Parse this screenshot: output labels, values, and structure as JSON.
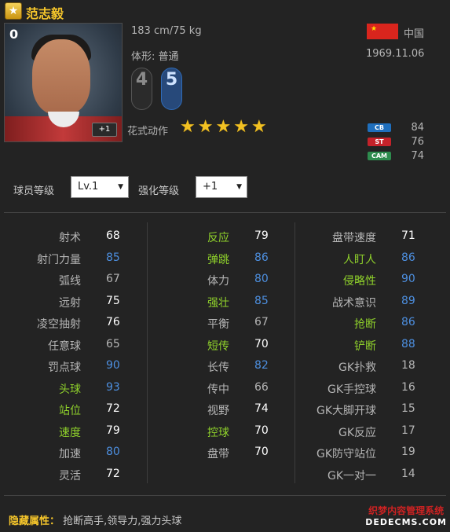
{
  "player": {
    "name": "范志毅",
    "overall": "0",
    "height_weight": "183 cm/75 kg",
    "body_type": "体形: 普通",
    "country": "中国",
    "dob": "1969.11.06",
    "weak_foot": "4",
    "strong_foot": "5",
    "skill_moves_label": "花式动作",
    "skill_stars": 5,
    "enhance_badge": "+1"
  },
  "positions": [
    {
      "tag": "CB",
      "value": "84",
      "color": "#1f6fbd"
    },
    {
      "tag": "ST",
      "value": "76",
      "color": "#c4222a"
    },
    {
      "tag": "CAM",
      "value": "74",
      "color": "#2e8c4e"
    }
  ],
  "controls": {
    "level_label": "球员等级",
    "level_value": "Lv.1",
    "enhance_label": "强化等级",
    "enhance_value": "+1"
  },
  "colors": {
    "green": "#8fd12b",
    "blue": "#4d8fe0",
    "white": "#ffffff",
    "gray": "#b5b5b5",
    "gold": "#f6c62b"
  },
  "stats": {
    "col1": [
      {
        "name": "射术",
        "value": "68",
        "nc": "gray",
        "vc": "white"
      },
      {
        "name": "射门力量",
        "value": "85",
        "nc": "gray",
        "vc": "blue"
      },
      {
        "name": "弧线",
        "value": "67",
        "nc": "gray",
        "vc": "gray"
      },
      {
        "name": "远射",
        "value": "75",
        "nc": "gray",
        "vc": "white"
      },
      {
        "name": "凌空抽射",
        "value": "76",
        "nc": "gray",
        "vc": "white"
      },
      {
        "name": "任意球",
        "value": "65",
        "nc": "gray",
        "vc": "gray"
      },
      {
        "name": "罚点球",
        "value": "90",
        "nc": "gray",
        "vc": "blue"
      },
      {
        "name": "头球",
        "value": "93",
        "nc": "green",
        "vc": "blue"
      },
      {
        "name": "站位",
        "value": "72",
        "nc": "green",
        "vc": "white"
      },
      {
        "name": "速度",
        "value": "79",
        "nc": "green",
        "vc": "white"
      },
      {
        "name": "加速",
        "value": "80",
        "nc": "gray",
        "vc": "blue"
      },
      {
        "name": "灵活",
        "value": "72",
        "nc": "gray",
        "vc": "white"
      }
    ],
    "col2": [
      {
        "name": "反应",
        "value": "79",
        "nc": "green",
        "vc": "white"
      },
      {
        "name": "弹跳",
        "value": "86",
        "nc": "green",
        "vc": "blue"
      },
      {
        "name": "体力",
        "value": "80",
        "nc": "gray",
        "vc": "blue"
      },
      {
        "name": "强壮",
        "value": "85",
        "nc": "green",
        "vc": "blue"
      },
      {
        "name": "平衡",
        "value": "67",
        "nc": "gray",
        "vc": "gray"
      },
      {
        "name": "短传",
        "value": "70",
        "nc": "green",
        "vc": "white"
      },
      {
        "name": "长传",
        "value": "82",
        "nc": "gray",
        "vc": "blue"
      },
      {
        "name": "传中",
        "value": "66",
        "nc": "gray",
        "vc": "gray"
      },
      {
        "name": "视野",
        "value": "74",
        "nc": "gray",
        "vc": "white"
      },
      {
        "name": "控球",
        "value": "70",
        "nc": "green",
        "vc": "white"
      },
      {
        "name": "盘带",
        "value": "70",
        "nc": "gray",
        "vc": "white"
      }
    ],
    "col3": [
      {
        "name": "盘带速度",
        "value": "71",
        "nc": "gray",
        "vc": "white"
      },
      {
        "name": "人盯人",
        "value": "86",
        "nc": "green",
        "vc": "blue"
      },
      {
        "name": "侵略性",
        "value": "90",
        "nc": "green",
        "vc": "blue"
      },
      {
        "name": "战术意识",
        "value": "89",
        "nc": "gray",
        "vc": "blue"
      },
      {
        "name": "抢断",
        "value": "86",
        "nc": "green",
        "vc": "blue"
      },
      {
        "name": "铲断",
        "value": "88",
        "nc": "green",
        "vc": "blue"
      },
      {
        "name": "GK扑救",
        "value": "18",
        "nc": "gray",
        "vc": "gray"
      },
      {
        "name": "GK手控球",
        "value": "16",
        "nc": "gray",
        "vc": "gray"
      },
      {
        "name": "GK大脚开球",
        "value": "15",
        "nc": "gray",
        "vc": "gray"
      },
      {
        "name": "GK反应",
        "value": "17",
        "nc": "gray",
        "vc": "gray"
      },
      {
        "name": "GK防守站位",
        "value": "19",
        "nc": "gray",
        "vc": "gray"
      },
      {
        "name": "GK一对一",
        "value": "14",
        "nc": "gray",
        "vc": "gray"
      }
    ]
  },
  "hidden": {
    "label": "隐藏属性：",
    "value": "抢断高手,领导力,强力头球"
  },
  "watermark": {
    "line1": "织梦内容管理系统",
    "line2": "DEDECMS.COM"
  }
}
